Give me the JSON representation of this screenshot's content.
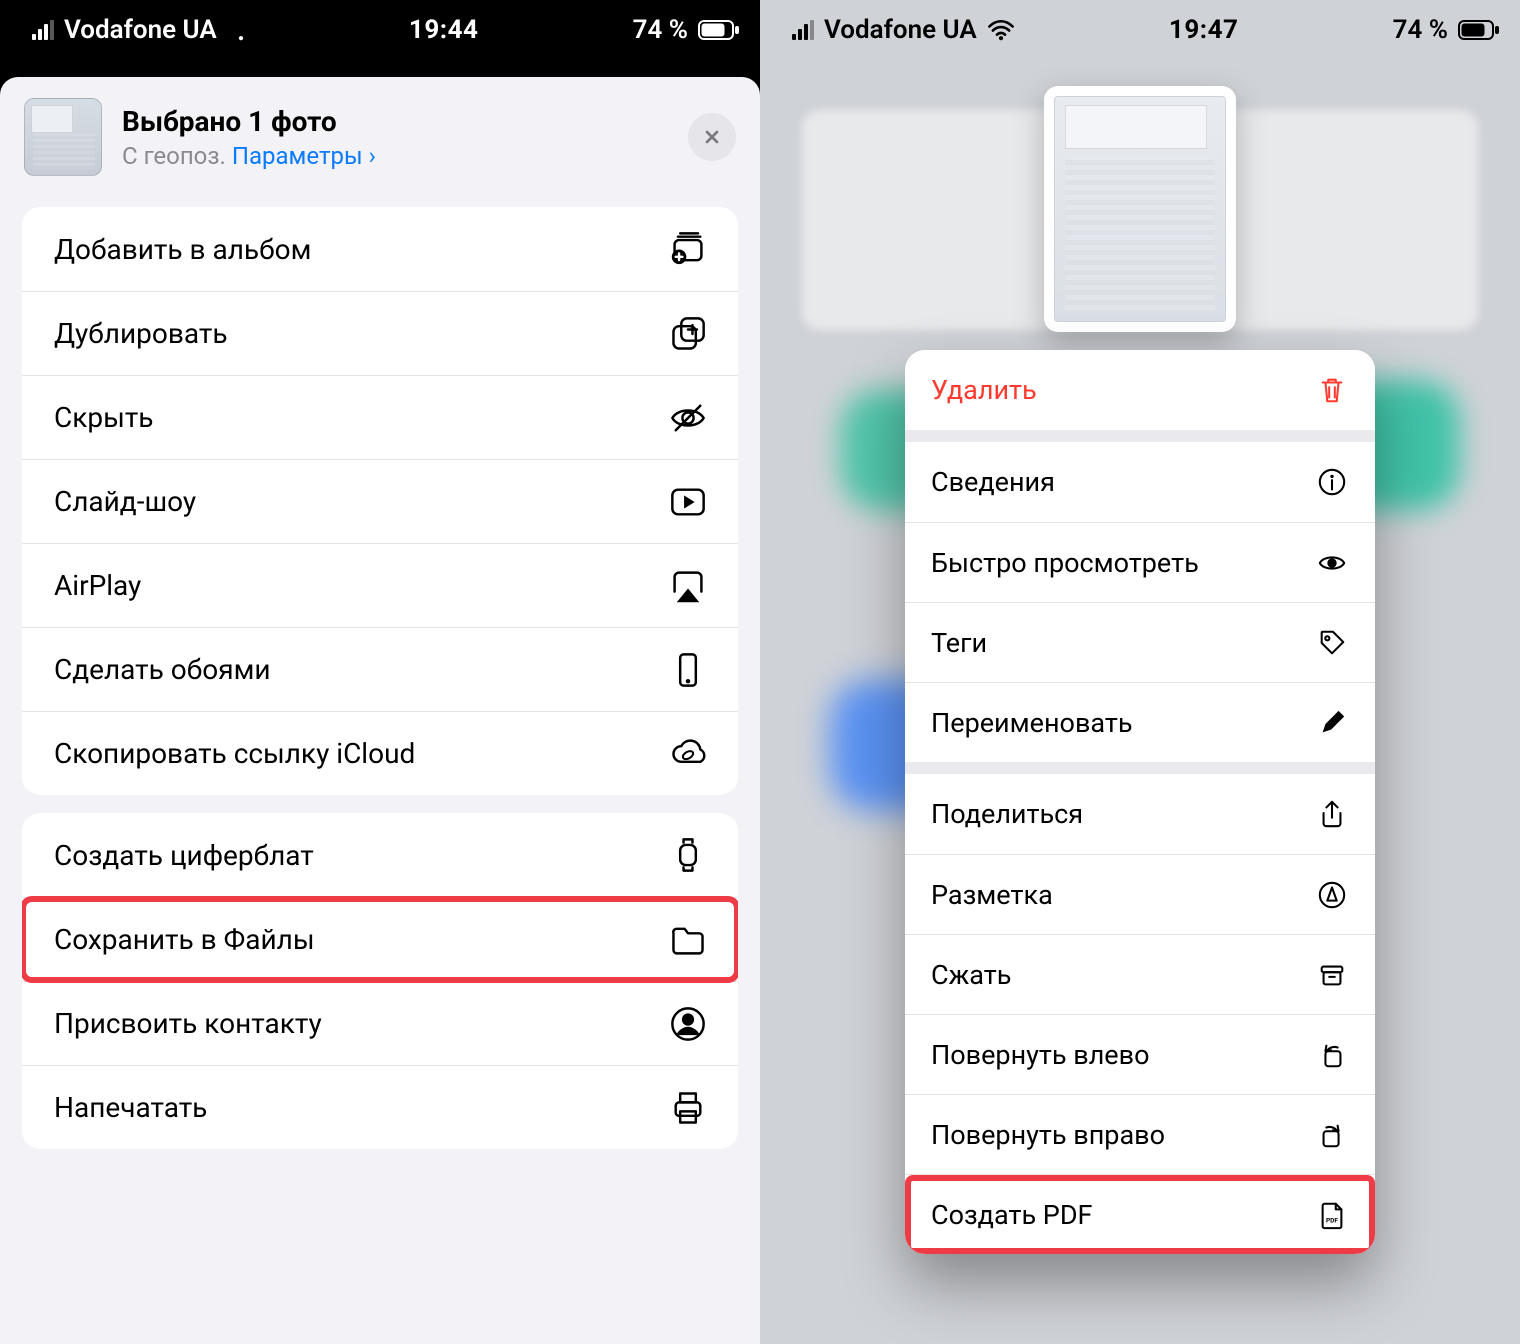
{
  "left": {
    "status": {
      "carrier": "Vodafone UA",
      "time": "19:44",
      "battery": "74 %"
    },
    "sheet": {
      "title": "Выбрано 1 фото",
      "subtitle_prefix": "С геопоз.  ",
      "subtitle_link": "Параметры"
    },
    "group_a": [
      {
        "label": "Добавить в альбом",
        "icon": "add-to-album-icon"
      },
      {
        "label": "Дублировать",
        "icon": "duplicate-icon"
      },
      {
        "label": "Скрыть",
        "icon": "hide-eye-icon"
      },
      {
        "label": "Слайд-шоу",
        "icon": "play-rect-icon"
      },
      {
        "label": "AirPlay",
        "icon": "airplay-icon"
      },
      {
        "label": "Сделать обоями",
        "icon": "phone-icon"
      },
      {
        "label": "Скопировать ссылку iCloud",
        "icon": "cloud-link-icon"
      }
    ],
    "group_b": [
      {
        "label": "Создать циферблат",
        "icon": "watch-icon"
      },
      {
        "label": "Сохранить в Файлы",
        "icon": "folder-icon",
        "highlight": true
      },
      {
        "label": "Присвоить контакту",
        "icon": "contact-icon"
      },
      {
        "label": "Напечатать",
        "icon": "printer-icon"
      }
    ]
  },
  "right": {
    "status": {
      "carrier": "Vodafone UA",
      "time": "19:47",
      "battery": "74 %"
    },
    "menu_a": [
      {
        "label": "Удалить",
        "icon": "trash-icon",
        "destructive": true
      }
    ],
    "menu_b": [
      {
        "label": "Сведения",
        "icon": "info-icon"
      },
      {
        "label": "Быстро просмотреть",
        "icon": "eye-icon"
      },
      {
        "label": "Теги",
        "icon": "tag-icon"
      },
      {
        "label": "Переименовать",
        "icon": "pencil-icon"
      }
    ],
    "menu_c": [
      {
        "label": "Поделиться",
        "icon": "share-icon"
      },
      {
        "label": "Разметка",
        "icon": "markup-icon"
      },
      {
        "label": "Сжать",
        "icon": "archive-icon"
      },
      {
        "label": "Повернуть влево",
        "icon": "rotate-left-icon"
      },
      {
        "label": "Повернуть вправо",
        "icon": "rotate-right-icon"
      },
      {
        "label": "Создать PDF",
        "icon": "pdf-icon",
        "highlight": true
      }
    ]
  }
}
